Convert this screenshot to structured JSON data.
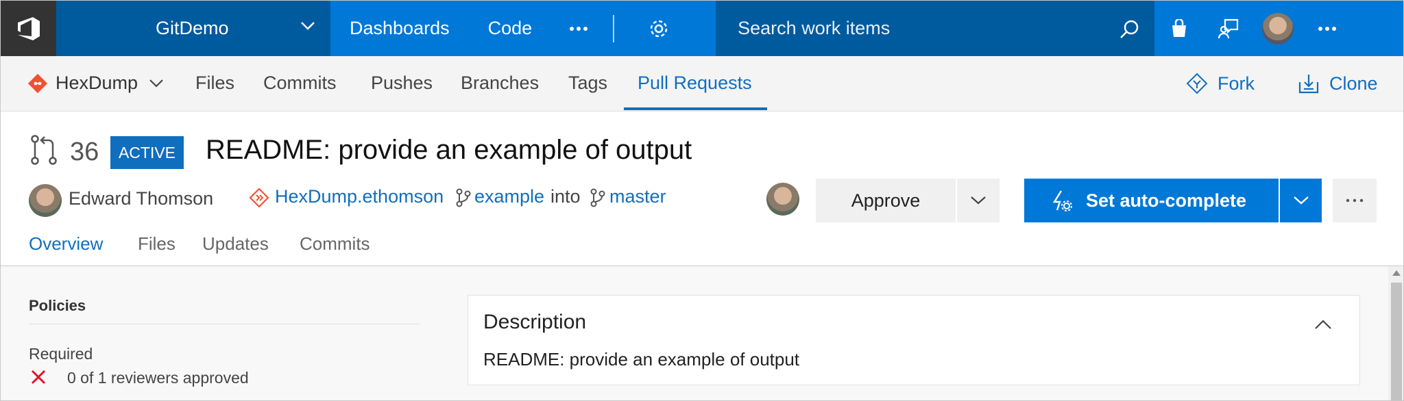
{
  "topbar": {
    "project": "GitDemo",
    "hubs": [
      {
        "label": "Dashboards"
      },
      {
        "label": "Code"
      }
    ],
    "search_placeholder": "Search work items"
  },
  "repobar": {
    "repo": "HexDump",
    "tabs": [
      "Files",
      "Commits",
      "Pushes",
      "Branches",
      "Tags",
      "Pull Requests"
    ],
    "active_tab": "Pull Requests",
    "fork_label": "Fork",
    "clone_label": "Clone"
  },
  "pr": {
    "number": "36",
    "status": "ACTIVE",
    "title": "README: provide an example of output",
    "author": "Edward Thomson",
    "source_repo": "HexDump.ethomson",
    "source_branch": "example",
    "into": "into",
    "target_branch": "master",
    "approve_label": "Approve",
    "autocomplete_label": "Set auto-complete",
    "tabs": [
      "Overview",
      "Files",
      "Updates",
      "Commits"
    ],
    "active_tab": "Overview"
  },
  "policies": {
    "title": "Policies",
    "required": "Required",
    "reviewers": "0 of 1 reviewers approved"
  },
  "description": {
    "title": "Description",
    "text": "README: provide an example of output"
  },
  "colors": {
    "accent": "#0078d7",
    "accent_dark": "#005a9e",
    "link": "#106ebe",
    "error": "#e81123",
    "git_orange": "#f05133"
  }
}
